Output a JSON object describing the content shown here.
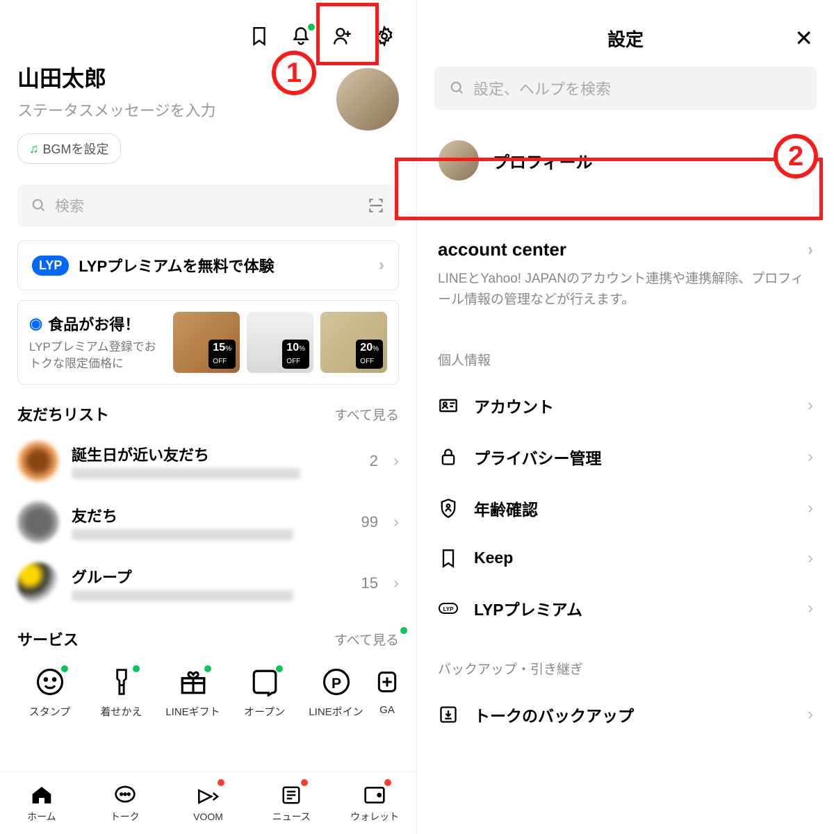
{
  "left": {
    "profile": {
      "name": "山田太郎",
      "status": "ステータスメッセージを入力",
      "bgm": "BGMを設定"
    },
    "search_placeholder": "検索",
    "lyp_banner": "LYPプレミアムを無料で体験",
    "lyp_badge": "LYP",
    "promo": {
      "title": "食品がお得！",
      "sub": "LYPプレミアム登録でおトクな限定価格に",
      "off1": "15",
      "off2": "10",
      "off3": "20"
    },
    "friends_head": "友だちリスト",
    "see_all": "すべて見る",
    "friends": [
      {
        "title": "誕生日が近い友だち",
        "count": "2"
      },
      {
        "title": "友だち",
        "count": "99"
      },
      {
        "title": "グループ",
        "count": "15"
      }
    ],
    "services_head": "サービス",
    "services": [
      {
        "label": "スタンプ"
      },
      {
        "label": "着せかえ"
      },
      {
        "label": "LINEギフト"
      },
      {
        "label": "オープン"
      },
      {
        "label": "LINEポイン"
      },
      {
        "label": "GA"
      }
    ],
    "nav": [
      {
        "label": "ホーム"
      },
      {
        "label": "トーク"
      },
      {
        "label": "VOOM"
      },
      {
        "label": "ニュース"
      },
      {
        "label": "ウォレット"
      }
    ]
  },
  "right": {
    "title": "設定",
    "search_placeholder": "設定、ヘルプを検索",
    "profile_label": "プロフィール",
    "account_center": {
      "title": "account center",
      "sub": "LINEとYahoo! JAPANのアカウント連携や連携解除、プロフィール情報の管理などが行えます。"
    },
    "personal_head": "個人情報",
    "items1": [
      {
        "label": "アカウント"
      },
      {
        "label": "プライバシー管理"
      },
      {
        "label": "年齢確認"
      },
      {
        "label": "Keep"
      },
      {
        "label": "LYPプレミアム"
      }
    ],
    "backup_head": "バックアップ・引き継ぎ",
    "items2": [
      {
        "label": "トークのバックアップ"
      }
    ]
  },
  "ann": {
    "n1": "1",
    "n2": "2"
  }
}
